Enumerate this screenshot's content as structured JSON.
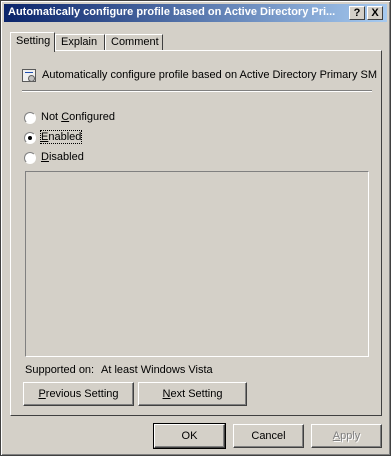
{
  "window": {
    "title": "Automatically configure profile based on Active Directory Pri...",
    "help_button": "?",
    "close_button": "X"
  },
  "tabs": [
    {
      "label": "Setting",
      "active": true
    },
    {
      "label": "Explain",
      "active": false
    },
    {
      "label": "Comment",
      "active": false
    }
  ],
  "policy": {
    "icon": "policy-setting-icon",
    "name": "Automatically configure profile based on Active Directory Primary SMT..."
  },
  "options": [
    {
      "pre": "Not ",
      "key": "C",
      "post": "onfigured",
      "checked": false
    },
    {
      "pre": "",
      "key": "E",
      "post": "nabled",
      "checked": true
    },
    {
      "pre": "",
      "key": "D",
      "post": "isabled",
      "checked": false
    }
  ],
  "supported": {
    "label": "Supported on:",
    "value": "At least Windows Vista"
  },
  "navigation": {
    "previous": {
      "key": "P",
      "rest": "revious Setting"
    },
    "next": {
      "key": "N",
      "rest": "ext Setting"
    }
  },
  "footer": {
    "ok": "OK",
    "cancel": "Cancel",
    "apply": {
      "key": "A",
      "rest": "pply",
      "enabled": false
    }
  }
}
